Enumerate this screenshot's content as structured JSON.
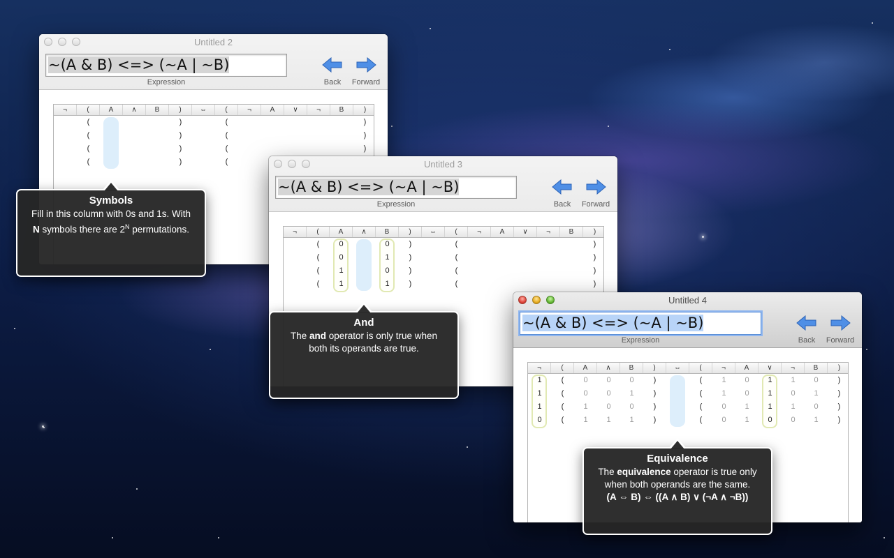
{
  "windows": [
    {
      "title": "Untitled 2",
      "expression": "~(A & B) <=> (~A | ~B)",
      "expression_label": "Expression",
      "back_label": "Back",
      "forward_label": "Forward",
      "columns": [
        "¬",
        "(",
        "A",
        "∧",
        "B",
        ")",
        "⇔",
        "(",
        "¬",
        "A",
        "∨",
        "¬",
        "B",
        ")"
      ],
      "rows": [
        [
          "",
          "(",
          "",
          "",
          "",
          ")",
          "",
          "(",
          "",
          "",
          "",
          "",
          "",
          ")"
        ],
        [
          "",
          "(",
          "",
          "",
          "",
          ")",
          "",
          "(",
          "",
          "",
          "",
          "",
          "",
          ")"
        ],
        [
          "",
          "(",
          "",
          "",
          "",
          ")",
          "",
          "(",
          "",
          "",
          "",
          "",
          "",
          ")"
        ],
        [
          "",
          "(",
          "",
          "",
          "",
          ")",
          "",
          "(",
          "",
          "",
          "",
          "",
          "",
          ")"
        ]
      ]
    },
    {
      "title": "Untitled 3",
      "expression": "~(A & B) <=> (~A | ~B)",
      "expression_label": "Expression",
      "back_label": "Back",
      "forward_label": "Forward",
      "columns": [
        "¬",
        "(",
        "A",
        "∧",
        "B",
        ")",
        "⇔",
        "(",
        "¬",
        "A",
        "∨",
        "¬",
        "B",
        ")"
      ],
      "rows": [
        [
          "",
          "(",
          "0",
          "",
          "0",
          ")",
          "",
          "(",
          "",
          "",
          "",
          "",
          "",
          ")"
        ],
        [
          "",
          "(",
          "0",
          "",
          "1",
          ")",
          "",
          "(",
          "",
          "",
          "",
          "",
          "",
          ")"
        ],
        [
          "",
          "(",
          "1",
          "",
          "0",
          ")",
          "",
          "(",
          "",
          "",
          "",
          "",
          "",
          ")"
        ],
        [
          "",
          "(",
          "1",
          "",
          "1",
          ")",
          "",
          "(",
          "",
          "",
          "",
          "",
          "",
          ")"
        ]
      ]
    },
    {
      "title": "Untitled 4",
      "expression": "~(A & B) <=> (~A | ~B)",
      "expression_label": "Expression",
      "back_label": "Back",
      "forward_label": "Forward",
      "columns": [
        "¬",
        "(",
        "A",
        "∧",
        "B",
        ")",
        "⇔",
        "(",
        "¬",
        "A",
        "∨",
        "¬",
        "B",
        ")"
      ],
      "rows": [
        [
          "1",
          "(",
          "0",
          "0",
          "0",
          ")",
          "",
          "(",
          "1",
          "0",
          "1",
          "1",
          "0",
          ")"
        ],
        [
          "1",
          "(",
          "0",
          "0",
          "1",
          ")",
          "",
          "(",
          "1",
          "0",
          "1",
          "0",
          "1",
          ")"
        ],
        [
          "1",
          "(",
          "1",
          "0",
          "0",
          ")",
          "",
          "(",
          "0",
          "1",
          "1",
          "1",
          "0",
          ")"
        ],
        [
          "0",
          "(",
          "1",
          "1",
          "1",
          ")",
          "",
          "(",
          "0",
          "1",
          "0",
          "0",
          "1",
          ")"
        ]
      ]
    }
  ],
  "tooltips": {
    "symbols": {
      "title": "Symbols",
      "line1": "Fill in this column with 0s and 1s. With",
      "line2_bold": "N",
      "line2_a": " symbols there are 2",
      "line2_sup": "N",
      "line2_b": " permutations."
    },
    "and": {
      "title": "And",
      "line1_a": "The ",
      "line1_bold": "and",
      "line1_b": " operator is only true when",
      "line2": "both its operands are true."
    },
    "equivalence": {
      "title": "Equivalence",
      "line1_a": "The ",
      "line1_bold": "equivalence",
      "line1_b": " operator is true only",
      "line2": "when both operands are the same.",
      "line3": "(A ⇔ B) ⇔ ((A ∧ B) ∨ (¬A ∧ ¬B))"
    }
  },
  "colors": {
    "column_highlight": "#ddeefb",
    "column_box": "#e1e9b3",
    "arrow_blue": "#4f8fe6"
  },
  "icons": {
    "back": "left-arrow-icon",
    "forward": "right-arrow-icon"
  }
}
